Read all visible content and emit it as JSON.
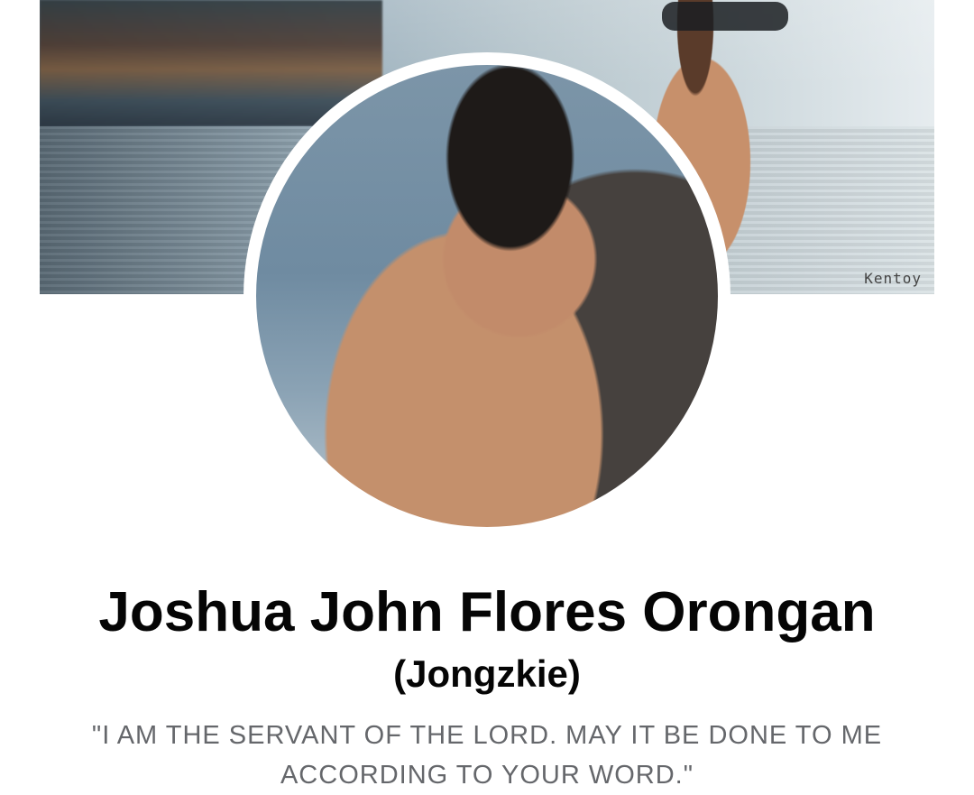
{
  "profile": {
    "cover_photo": {
      "watermark": "Kentoy"
    },
    "name": "Joshua John Flores Orongan",
    "alternate_name": "(Jongzkie)",
    "bio": "\"I AM THE SERVANT OF THE LORD. MAY IT BE DONE TO ME ACCORDING TO YOUR WORD.\""
  }
}
